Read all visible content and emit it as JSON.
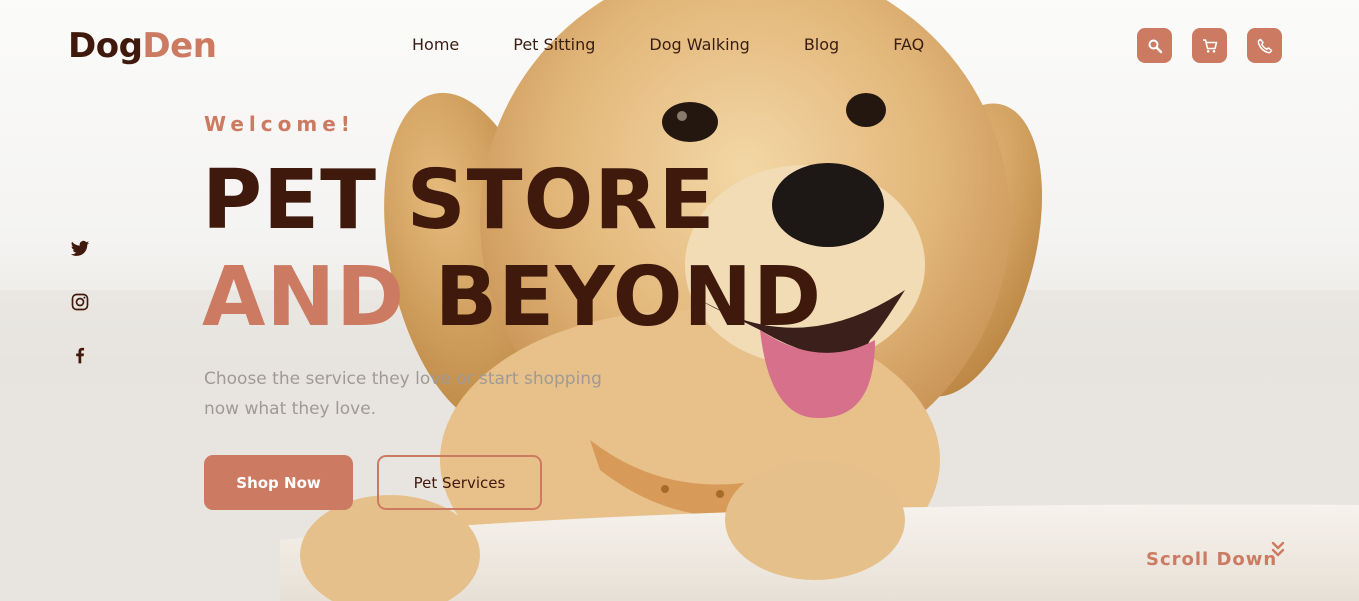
{
  "brand": {
    "part1": "Dog",
    "part2": "Den"
  },
  "nav": {
    "items": [
      "Home",
      "Pet Sitting",
      "Dog Walking",
      "Blog",
      "FAQ"
    ]
  },
  "header_icons": [
    "search-icon",
    "cart-icon",
    "phone-icon"
  ],
  "social_icons": [
    "twitter-icon",
    "instagram-icon",
    "facebook-icon"
  ],
  "hero": {
    "welcome": "Welcome!",
    "line1": "PET STORE",
    "line2_accent": "AND",
    "line2_rest": "BEYOND",
    "subtitle_line1": "Choose the service they love or start shopping",
    "subtitle_line2": "now what they love.",
    "primary_button": "Shop Now",
    "secondary_button": "Pet Services",
    "scroll_label": "Scroll Down"
  },
  "colors": {
    "accent": "#cc7b62",
    "dark": "#3f1a0c",
    "muted": "#a09a95"
  }
}
